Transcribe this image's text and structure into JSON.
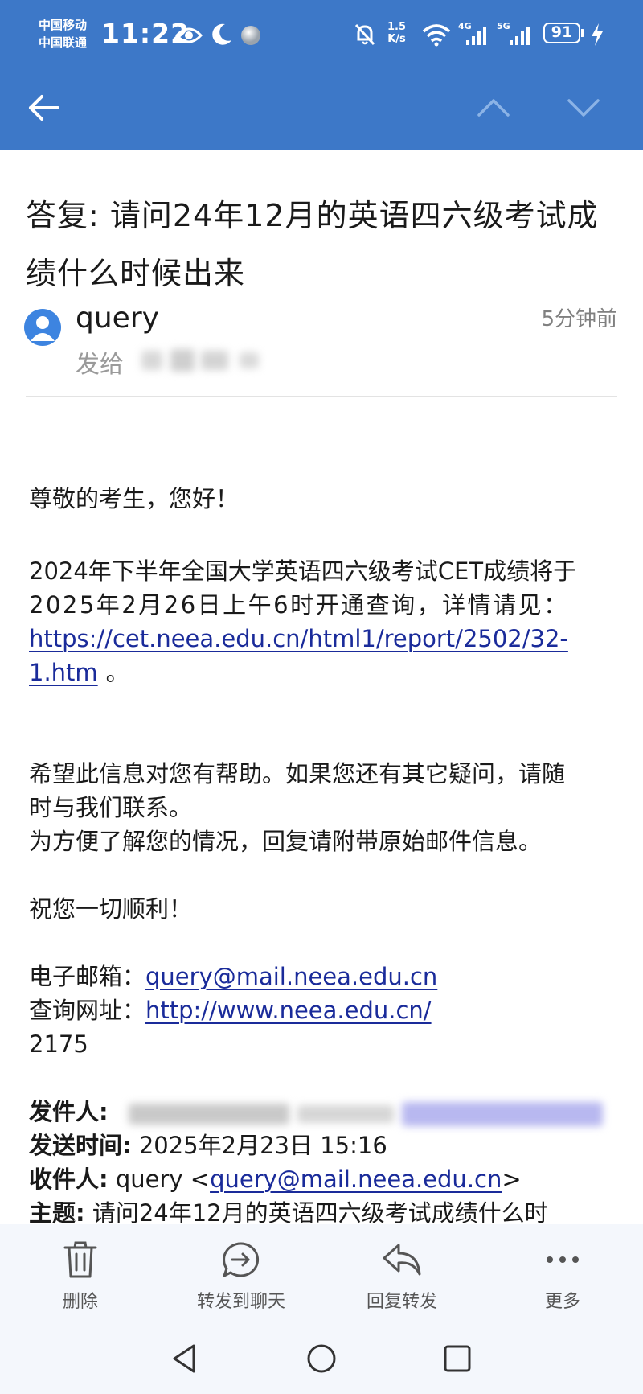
{
  "status_bar": {
    "carrier_1": "中国移动",
    "carrier_2": "中国联通",
    "time": "11:22",
    "net_speed_value": "1.5",
    "net_speed_unit": "K/s",
    "signal_1_label": "4G",
    "signal_2_label": "5G",
    "battery_level": "91"
  },
  "header_nav": {
    "back_icon": "back-arrow-icon",
    "prev_icon": "chevron-up-icon",
    "next_icon": "chevron-down-icon"
  },
  "email": {
    "subject_line_1": "答复: 请问24年12月的英语四六级考试成",
    "subject_line_2": "绩什么时候出来",
    "sender_name": "query",
    "time_ago": "5分钟前",
    "to_label": "发给"
  },
  "body": {
    "greeting": "尊敬的考生，您好！",
    "para1_line1": "2024年下半年全国大学英语四六级考试CET成绩将于",
    "para1_line2": "2025年2月26日上午6时开通查询，详情请见：",
    "link_part1": "https://cet.neea.edu.cn/html1/report/2502/32-",
    "link_part2": "1.htm",
    "link_suffix": "。",
    "para2_line1": "希望此信息对您有帮助。如果您还有其它疑问，请随",
    "para2_line2": "时与我们联系。",
    "para2_line3": "为方便了解您的情况，回复请附带原始邮件信息。",
    "wish": "祝您一切顺利！",
    "email_label": "电子邮箱：",
    "email_value": "query@mail.neea.edu.cn",
    "site_label": "查询网址：",
    "site_value": "http://www.neea.edu.cn/",
    "code": "2175",
    "orig_from_label": "发件人:",
    "orig_time_label": "发送时间:",
    "orig_time_value": "2025年2月23日 15:16",
    "orig_to_label": "收件人:",
    "orig_to_name": "query <",
    "orig_to_email": "query@mail.neea.edu.cn",
    "orig_to_close": ">",
    "orig_subject_label": "主题:",
    "orig_subject_value": "请问24年12月的英语四六级考试成绩什么时"
  },
  "toolbar": {
    "delete_label": "删除",
    "forward_chat_label": "转发到聊天",
    "reply_forward_label": "回复转发",
    "more_label": "更多"
  },
  "colors": {
    "header_blue": "#3d78c8",
    "link": "#1a2b9a",
    "toolbar_bg": "#f4f7fc"
  }
}
